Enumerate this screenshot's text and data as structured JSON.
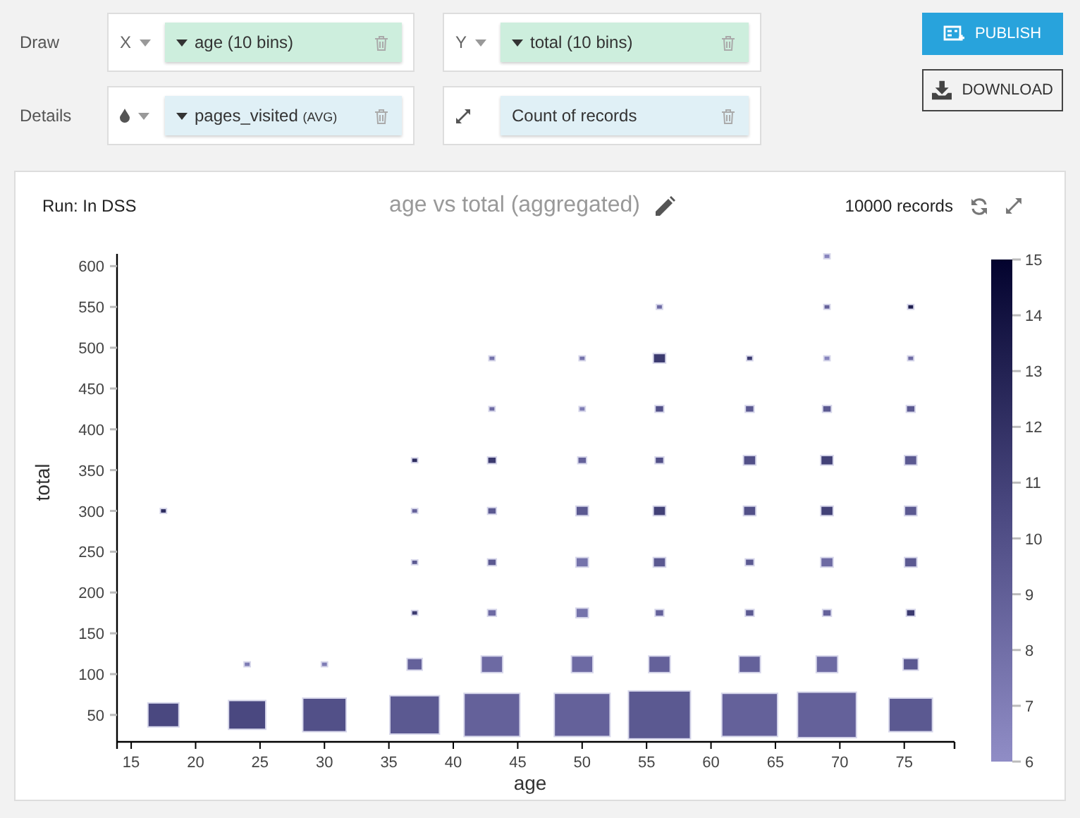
{
  "controls": [
    {
      "label": "Draw",
      "slots": [
        {
          "axis": "X",
          "kind": "dimension",
          "field": "age (10 bins)",
          "color": "#cdeedd",
          "has_caret": true
        },
        {
          "axis": "Y",
          "kind": "dimension",
          "field": "total (10 bins)",
          "color": "#cdeedd",
          "has_caret": true
        }
      ]
    },
    {
      "label": "Details",
      "slots": [
        {
          "kind": "color",
          "field": "pages_visited",
          "suffix": "(AVG)",
          "color": "#e0f0f6",
          "has_caret": true
        },
        {
          "kind": "size",
          "field": "Count of records",
          "color": "#e0f0f6",
          "has_caret": false
        }
      ]
    }
  ],
  "buttons": [
    {
      "kind": "publish",
      "label": "PUBLISH"
    },
    {
      "kind": "download",
      "label": "DOWNLOAD"
    }
  ],
  "chart_header": {
    "engine": "Run: In DSS",
    "title": "age vs total (aggregated)",
    "records": "10000 records"
  },
  "chart_data": {
    "type": "scatter",
    "xlabel": "age",
    "ylabel": "total",
    "xlim": [
      13.9,
      78.9
    ],
    "ylim": [
      17,
      615
    ],
    "xticks": [
      15,
      20,
      25,
      30,
      35,
      40,
      45,
      50,
      55,
      60,
      65,
      70,
      75
    ],
    "yticks": [
      50,
      100,
      150,
      200,
      250,
      300,
      350,
      400,
      450,
      500,
      550,
      600
    ],
    "x": [
      17.5,
      24,
      30,
      37,
      43,
      50,
      56,
      63,
      69,
      75.5,
      24,
      30,
      37,
      43,
      50,
      56,
      63,
      69,
      75.5,
      37,
      43,
      50,
      56,
      63,
      69,
      75.5,
      37,
      43,
      50,
      56,
      63,
      69,
      75.5,
      17.5,
      37,
      43,
      50,
      56,
      63,
      69,
      75.5,
      37,
      43,
      50,
      56,
      63,
      69,
      75.5,
      43,
      50,
      56,
      63,
      69,
      75.5,
      43,
      50,
      56,
      63,
      69,
      75.5,
      56,
      69,
      75.5,
      69
    ],
    "series": [
      {
        "values": [
          50,
          50,
          50,
          50,
          50,
          50,
          50,
          50,
          50,
          50,
          112,
          112,
          112,
          112,
          112,
          112,
          112,
          112,
          112,
          175,
          175,
          175,
          175,
          175,
          175,
          175,
          237,
          237,
          237,
          237,
          237,
          237,
          237,
          300,
          300,
          300,
          300,
          300,
          300,
          300,
          300,
          362,
          362,
          362,
          362,
          362,
          362,
          362,
          425,
          425,
          425,
          425,
          425,
          425,
          487,
          487,
          487,
          487,
          487,
          487,
          550,
          550,
          550,
          612
        ],
        "sizes": [
          0.25,
          0.36,
          0.49,
          0.64,
          0.81,
          0.81,
          1,
          0.81,
          0.9,
          0.49,
          0.01,
          0.01,
          0.06,
          0.12,
          0.12,
          0.12,
          0.12,
          0.12,
          0.06,
          0.01,
          0.02,
          0.04,
          0.02,
          0.02,
          0.02,
          0.02,
          0.01,
          0.02,
          0.04,
          0.04,
          0.02,
          0.04,
          0.04,
          0.01,
          0.01,
          0.02,
          0.04,
          0.04,
          0.04,
          0.04,
          0.04,
          0.01,
          0.02,
          0.02,
          0.02,
          0.04,
          0.04,
          0.04,
          0.01,
          0.01,
          0.02,
          0.02,
          0.02,
          0.02,
          0.01,
          0.01,
          0.04,
          0.01,
          0.01,
          0.01,
          0.01,
          0.01,
          0.01,
          0.01
        ],
        "colors": [
          "#4a4880",
          "#4a4880",
          "#525088",
          "#5b5991",
          "#64619a",
          "#64619a",
          "#5b5991",
          "#64619a",
          "#64619a",
          "#5b5991",
          "#7e7cb4",
          "#7e7cb4",
          "#64619a",
          "#6d6aa3",
          "#6d6aa3",
          "#64619a",
          "#64619a",
          "#6d6aa3",
          "#5b5991",
          "#3b3a6f",
          "#6d6aa3",
          "#7573ab",
          "#64619a",
          "#5b5991",
          "#64619a",
          "#3b3a6f",
          "#5b5991",
          "#5b5991",
          "#7573ab",
          "#5b5991",
          "#5b5991",
          "#6d6aa3",
          "#5b5991",
          "#2d2c5f",
          "#64619a",
          "#5b5991",
          "#5b5991",
          "#424177",
          "#525088",
          "#424177",
          "#5b5991",
          "#2d2c5f",
          "#3b3a6f",
          "#64619a",
          "#525088",
          "#525088",
          "#424177",
          "#5b5991",
          "#6d6aa3",
          "#7e7cb4",
          "#525088",
          "#5b5991",
          "#5b5991",
          "#5b5991",
          "#7573ab",
          "#7573ab",
          "#3b3a6f",
          "#3b3a6f",
          "#8784bd",
          "#6d6aa3",
          "#6d6aa3",
          "#64619a",
          "#1f1e4f",
          "#8784bd"
        ]
      }
    ]
  },
  "color_legend": {
    "labels": [
      "15",
      "14",
      "13",
      "12",
      "11",
      "10",
      "9",
      "8",
      "7",
      "6"
    ]
  }
}
